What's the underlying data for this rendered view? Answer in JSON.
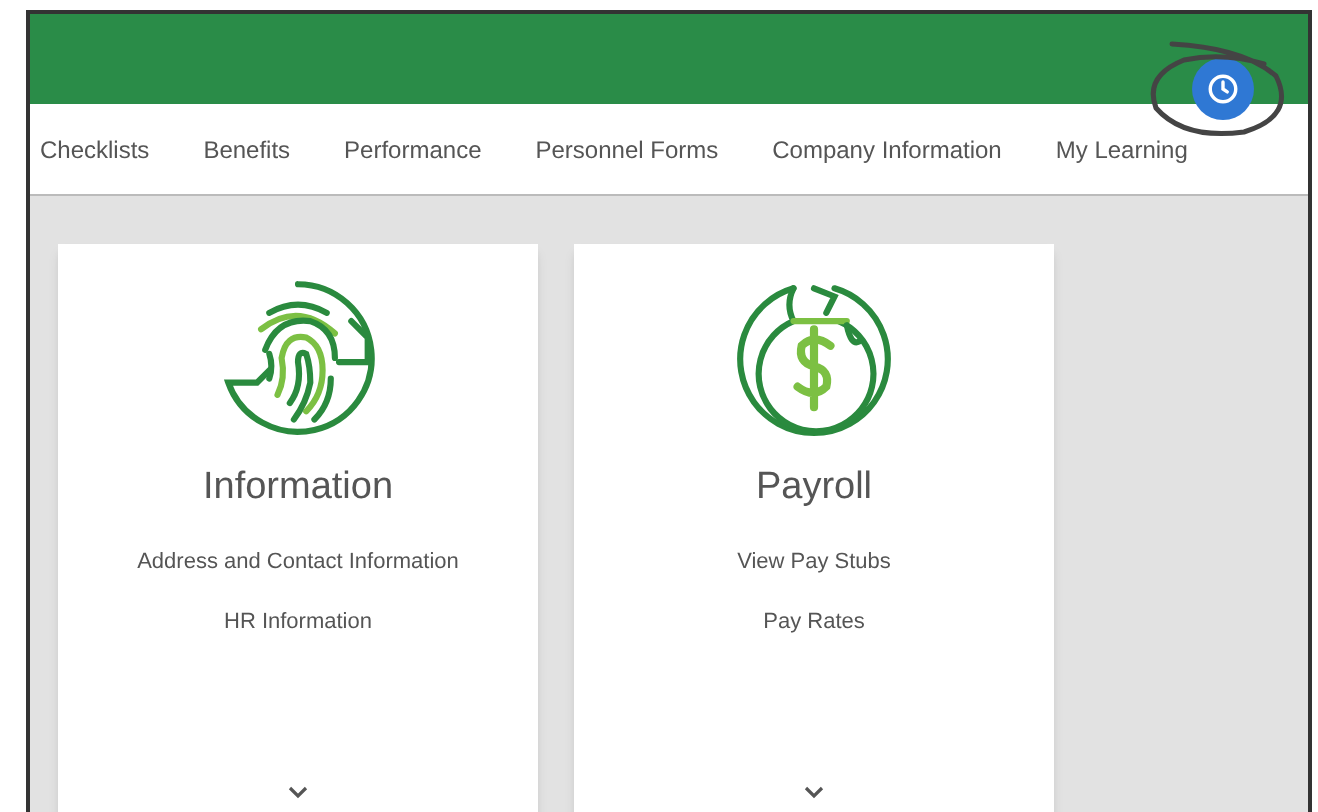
{
  "nav": {
    "items": [
      {
        "label": "Checklists"
      },
      {
        "label": "Benefits"
      },
      {
        "label": "Performance"
      },
      {
        "label": "Personnel Forms"
      },
      {
        "label": "Company Information"
      },
      {
        "label": "My Learning"
      }
    ]
  },
  "cards": [
    {
      "title": "Information",
      "links": [
        "Address and Contact Information",
        "HR Information"
      ]
    },
    {
      "title": "Payroll",
      "links": [
        "View Pay Stubs",
        "Pay Rates"
      ]
    }
  ]
}
